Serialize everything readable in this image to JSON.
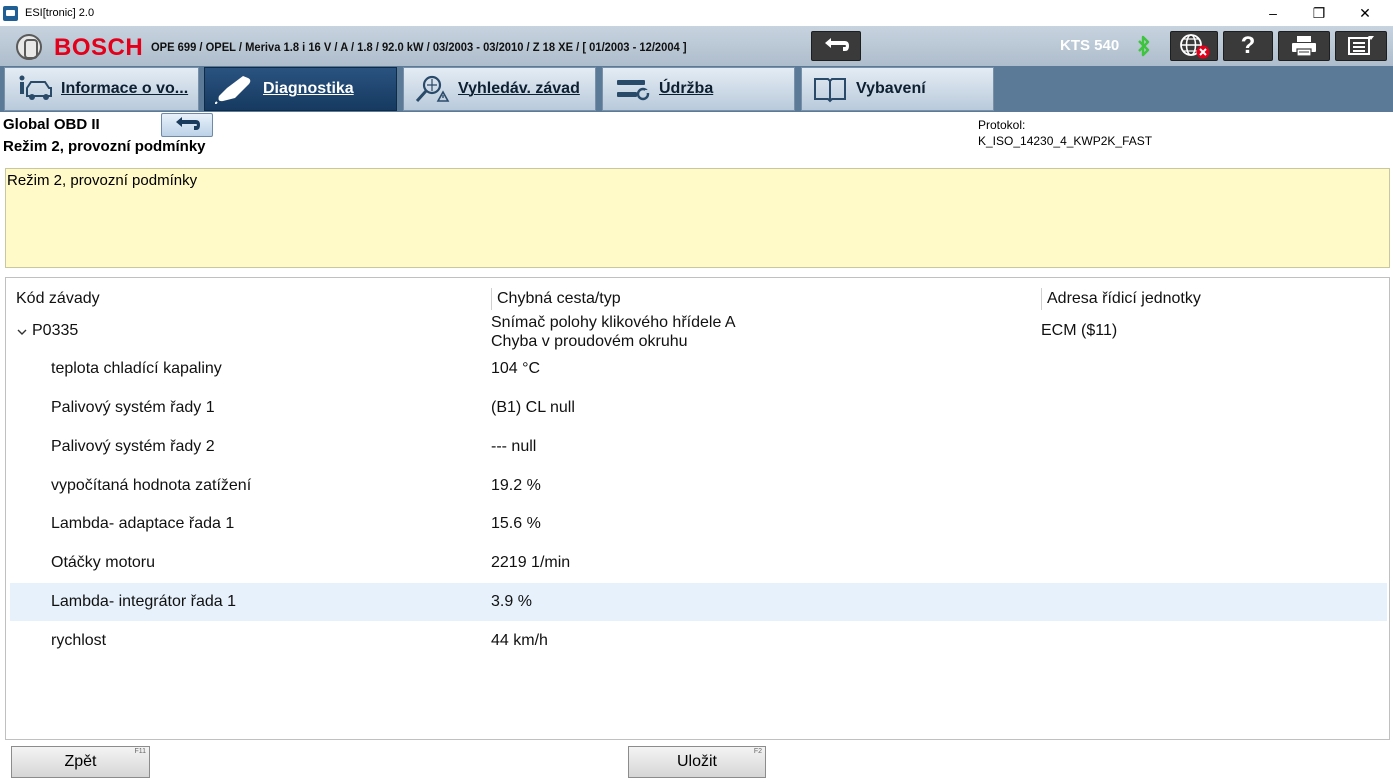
{
  "window": {
    "title": "ESI[tronic] 2.0",
    "minimize": "–",
    "maximize": "❐",
    "close": "✕"
  },
  "header": {
    "brand": "BOSCH",
    "vehicle": "OPE 699 / OPEL / Meriva 1.8 i 16 V / A / 1.8 / 92.0 kW / 03/2003 - 03/2010 / Z 18 XE / [ 01/2003 - 12/2004 ]",
    "device": "KTS 540",
    "help_label": "?"
  },
  "tabs": [
    {
      "label": "Informace o vo...",
      "active": false
    },
    {
      "label": "Diagnostika",
      "active": true
    },
    {
      "label": "Vyhledáv. závad",
      "active": false
    },
    {
      "label": "Údržba",
      "active": false
    },
    {
      "label": "Vybavení",
      "active": false
    }
  ],
  "info": {
    "title": "Global OBD II",
    "subtitle": "Režim 2,  provozní podmínky",
    "protocol_label": "Protokol:",
    "protocol_value": "K_ISO_14230_4_KWP2K_FAST"
  },
  "description": {
    "text": "Režim 2,  provozní podmínky"
  },
  "table": {
    "headers": [
      "Kód závady",
      "Chybná cesta/typ",
      "Adresa řídicí jednotky"
    ],
    "fault": {
      "code": "P0335",
      "desc_line1": "Snímač polohy klikového hřídele A",
      "desc_line2": "Chyba v proudovém okruhu",
      "address": "ECM ($11)"
    },
    "params": [
      {
        "name": "teplota chladící kapaliny",
        "value": "104 °C"
      },
      {
        "name": "Palivový systém řady 1",
        "value": "(B1) CL null"
      },
      {
        "name": "Palivový systém řady 2",
        "value": "--- null"
      },
      {
        "name": "vypočítaná hodnota zatížení",
        "value": "19.2 %"
      },
      {
        "name": "Lambda- adaptace řada 1",
        "value": "15.6 %"
      },
      {
        "name": "Otáčky motoru",
        "value": "2219 1/min"
      },
      {
        "name": "Lambda- integrátor řada 1",
        "value": "3.9 %"
      },
      {
        "name": "rychlost",
        "value": "44 km/h"
      }
    ]
  },
  "footer": {
    "back_label": "Zpět",
    "back_key": "F11",
    "save_label": "Uložit",
    "save_key": "F2"
  },
  "colors": {
    "brand_red": "#e2001a",
    "active_tab": "#1f4770",
    "highlight_row": "#e6f1fb",
    "yellow_panel": "#fffac8"
  }
}
